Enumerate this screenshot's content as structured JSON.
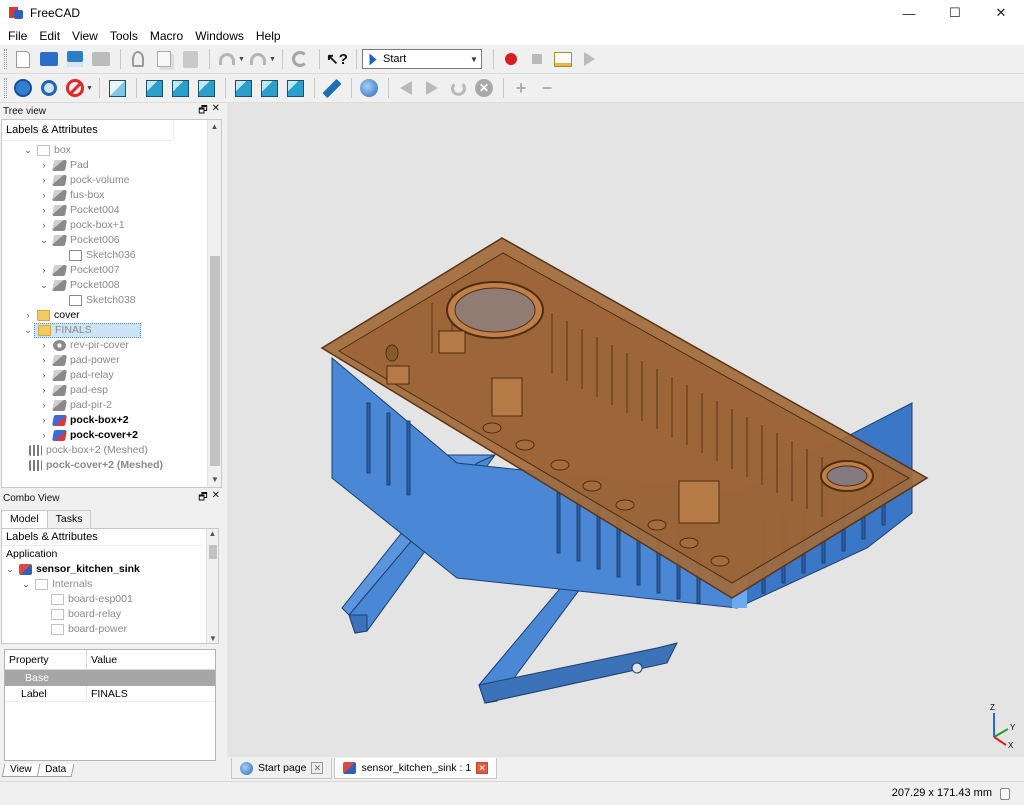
{
  "window": {
    "title": "FreeCAD",
    "minimize": "—",
    "maximize": "☐",
    "close": "✕"
  },
  "menu": [
    "File",
    "Edit",
    "View",
    "Tools",
    "Macro",
    "Windows",
    "Help"
  ],
  "workbench": {
    "selected": "Start"
  },
  "tree_view": {
    "title": "Tree view",
    "header": "Labels & Attributes",
    "items": [
      {
        "label": "box"
      },
      {
        "label": "Pad"
      },
      {
        "label": "pock-volume"
      },
      {
        "label": "fus-box"
      },
      {
        "label": "Pocket004"
      },
      {
        "label": "pock-box+1"
      },
      {
        "label": "Pocket006"
      },
      {
        "label": "Sketch036"
      },
      {
        "label": "Pocket007"
      },
      {
        "label": "Pocket008"
      },
      {
        "label": "Sketch038"
      },
      {
        "label": "cover"
      },
      {
        "label": "FINALS"
      },
      {
        "label": "rev-pir-cover"
      },
      {
        "label": "pad-power"
      },
      {
        "label": "pad-relay"
      },
      {
        "label": "pad-esp"
      },
      {
        "label": "pad-pir-2"
      },
      {
        "label": "pock-box+2"
      },
      {
        "label": "pock-cover+2"
      },
      {
        "label": "pock-box+2 (Meshed)"
      },
      {
        "label": "pock-cover+2 (Meshed)"
      }
    ]
  },
  "combo_view": {
    "title": "Combo View",
    "tabs": [
      "Model",
      "Tasks"
    ],
    "header": "Labels & Attributes",
    "application": "Application",
    "document": "sensor_kitchen_sink",
    "items": [
      "Internals",
      "board-esp001",
      "board-relay",
      "board-power"
    ]
  },
  "properties": {
    "col_property": "Property",
    "col_value": "Value",
    "group": "Base",
    "rows": [
      {
        "name": "Label",
        "value": "FINALS"
      }
    ]
  },
  "bottom_tabs": [
    "View",
    "Data"
  ],
  "doc_tabs": [
    "Start page",
    "sensor_kitchen_sink : 1"
  ],
  "status": {
    "dimensions": "207.29 x 171.43 mm"
  },
  "axis": {
    "x": "X",
    "y": "Y",
    "z": "Z"
  },
  "colors": {
    "box_blue": "#3f7fd0",
    "cover_brown": "#9a6436",
    "view_bg": "#e4e4e4"
  }
}
